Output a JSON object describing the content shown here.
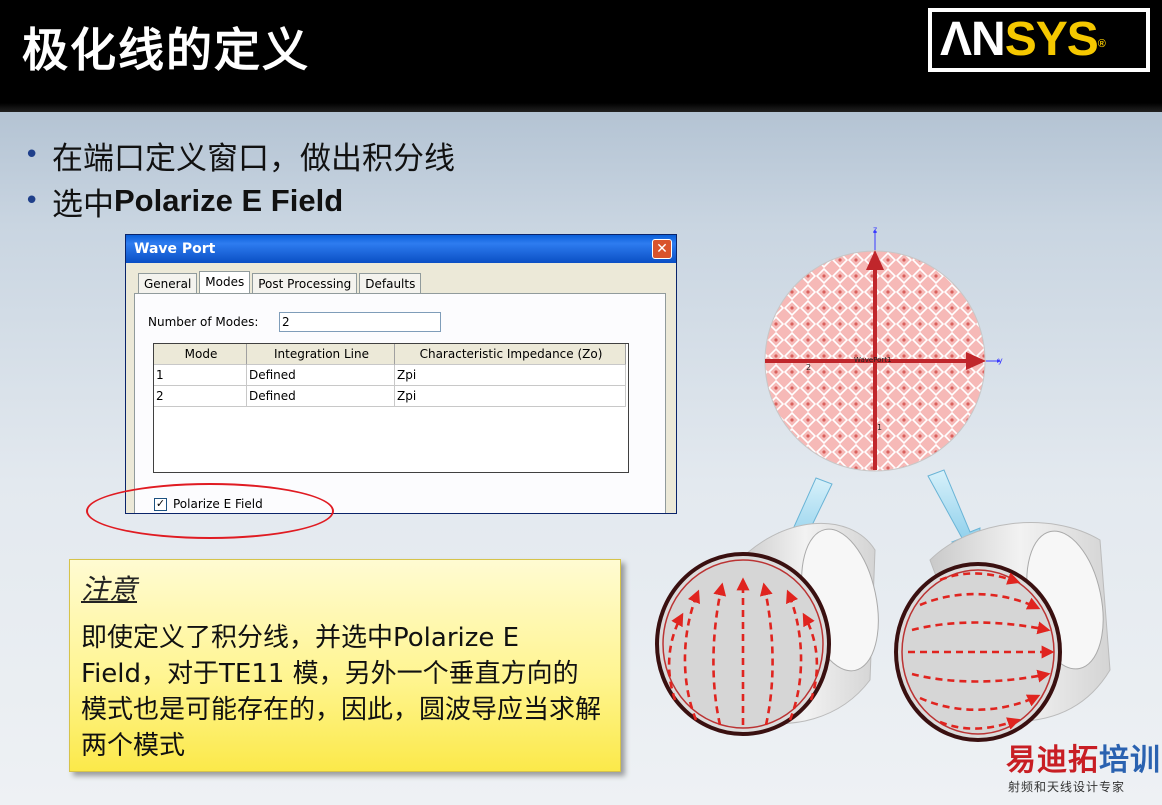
{
  "slide": {
    "title": "极化线的定义",
    "logo": {
      "text_an": "ΛN",
      "text_sys": "SYS",
      "mark": "®"
    }
  },
  "bullets": [
    {
      "text": "在端口定义窗口，做出积分线"
    },
    {
      "prefix": "选中",
      "bold": "Polarize E Field"
    }
  ],
  "dialog": {
    "title": "Wave Port",
    "close_glyph": "✕",
    "tabs": [
      "General",
      "Modes",
      "Post Processing",
      "Defaults"
    ],
    "active_tab": "Modes",
    "num_modes_label": "Number of Modes:",
    "num_modes_value": "2",
    "table": {
      "headers": [
        "Mode",
        "Integration Line",
        "Characteristic Impedance (Zo)"
      ],
      "rows": [
        [
          "1",
          "Defined",
          "Zpi"
        ],
        [
          "2",
          "Defined",
          "Zpi"
        ]
      ]
    },
    "checkbox": {
      "label": "Polarize E Field",
      "checked": true,
      "check_glyph": "✓"
    }
  },
  "note": {
    "title": "注意",
    "body": "即使定义了积分线，并选中Polarize E Field，对于TE11 模，另外一个垂直方向的模式也是可能存在的，因此，圆波导应当求解两个模式"
  },
  "figure": {
    "axis_z": "z",
    "axis_y": "y",
    "port_label": "WavePort1",
    "marker_1": "1",
    "marker_2": "2",
    "colors": {
      "port_fill": "#f4a7a7",
      "axis": "#c0262b",
      "arrow": "#9ed6ee",
      "field": "#e0241f"
    }
  },
  "watermark": {
    "main_red": "易迪拓",
    "main_blue": "培训",
    "sub": "射频和天线设计专家"
  }
}
